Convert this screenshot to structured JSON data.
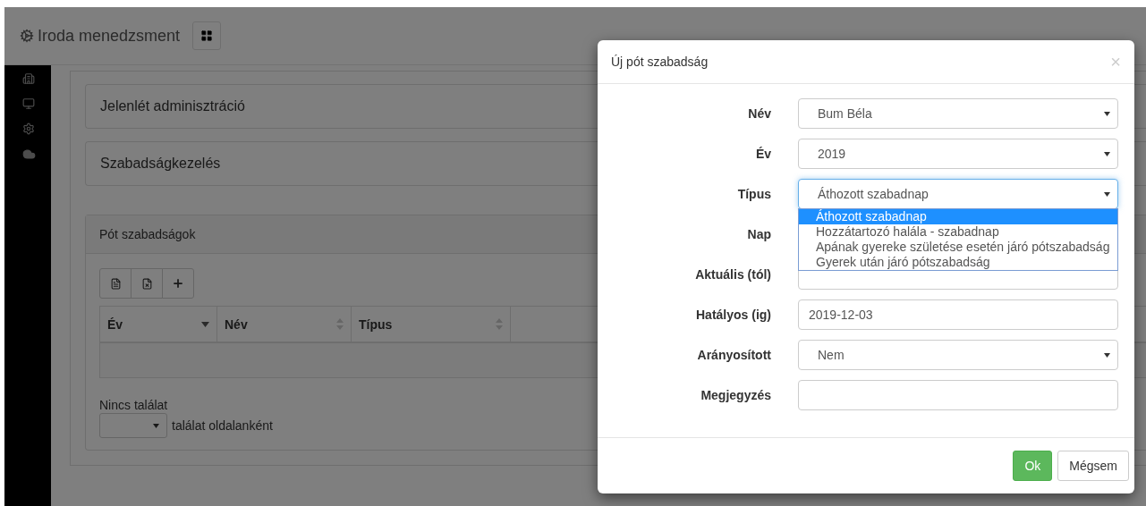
{
  "app": {
    "title": "Iroda menedzsment"
  },
  "sections": [
    {
      "title": "Jelenlét adminisztráció"
    },
    {
      "title": "Szabadságkezelés"
    }
  ],
  "panel": {
    "title": "Pót szabadságok",
    "columns": [
      {
        "label": "Év",
        "sorted": true
      },
      {
        "label": "Név",
        "sorted": false
      },
      {
        "label": "Típus",
        "sorted": false
      }
    ],
    "empty_text": "Nincs találat",
    "page_size_label": "találat oldalanként"
  },
  "dialog": {
    "title": "Új pót szabadság",
    "close": "×",
    "fields": [
      {
        "label": "Név",
        "kind": "select",
        "value": "Bum Béla"
      },
      {
        "label": "Év",
        "kind": "select",
        "value": "2019"
      },
      {
        "label": "Típus",
        "kind": "select",
        "value": "Áthozott szabadnap",
        "expanded": true,
        "options": [
          {
            "label": "Áthozott szabadnap",
            "selected": true
          },
          {
            "label": "Hozzátartozó halála - szabadnap",
            "selected": false
          },
          {
            "label": "Apának gyereke születése esetén járó pótszabadság",
            "selected": false
          },
          {
            "label": "Gyerek után járó pótszabadság",
            "selected": false
          }
        ]
      },
      {
        "label": "Nap",
        "kind": "input"
      },
      {
        "label": "Aktuális (tól)",
        "kind": "input"
      },
      {
        "label": "Hatályos (ig)",
        "kind": "input",
        "value": "2019-12-03"
      },
      {
        "label": "Arányosított",
        "kind": "select",
        "value": "Nem"
      },
      {
        "label": "Megjegyzés",
        "kind": "input"
      }
    ],
    "buttons": [
      {
        "label": "Ok",
        "kind": "primary"
      },
      {
        "label": "Mégsem",
        "kind": "default"
      }
    ]
  }
}
